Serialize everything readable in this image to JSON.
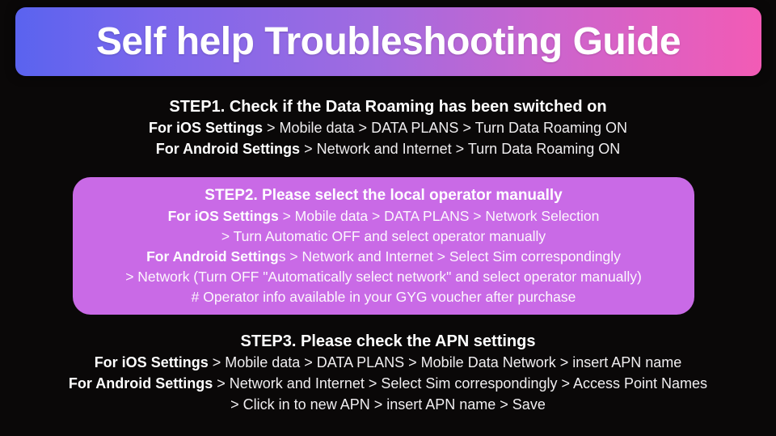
{
  "banner": {
    "title": "Self help Troubleshooting Guide",
    "gradient_start": "#5a63ef",
    "gradient_mid": "#a16be0",
    "gradient_end": "#f25bb5"
  },
  "page": {
    "background": "#0a0808",
    "text_color": "#ffffff"
  },
  "steps": [
    {
      "id": "step1",
      "heading": "STEP1. Check if the Data Roaming has been switched on",
      "highlight": false,
      "lines": [
        {
          "bold": "For iOS Settings",
          "rest": " > Mobile data > DATA PLANS > Turn Data Roaming ON"
        },
        {
          "bold": "For Android Settings",
          "rest": " > Network and Internet > Turn Data Roaming ON"
        }
      ]
    },
    {
      "id": "step2",
      "heading": "STEP2. Please select the local operator manually",
      "highlight": true,
      "highlight_color": "#c96ae6",
      "lines": [
        {
          "bold": "For iOS Settings",
          "rest": " > Mobile data > DATA PLANS > Network Selection"
        },
        {
          "bold": "",
          "rest": "> Turn Automatic OFF and select operator manually"
        },
        {
          "bold": "For Android Setting",
          "rest": "s > Network and Internet > Select Sim correspondingly"
        },
        {
          "bold": "",
          "rest": "> Network (Turn OFF \"Automatically select network\" and select operator manually)"
        },
        {
          "bold": "",
          "rest": "# Operator info available in your GYG voucher after purchase"
        }
      ]
    },
    {
      "id": "step3",
      "heading": "STEP3. Please check the APN settings",
      "highlight": false,
      "lines": [
        {
          "bold": "For iOS Settings",
          "rest": " > Mobile data > DATA PLANS > Mobile Data Network > insert APN name"
        },
        {
          "bold": "For Android Settings",
          "rest": " > Network and Internet > Select Sim correspondingly > Access Point Names"
        },
        {
          "bold": "",
          "rest": "> Click in to new APN > insert APN name > Save"
        }
      ]
    }
  ]
}
